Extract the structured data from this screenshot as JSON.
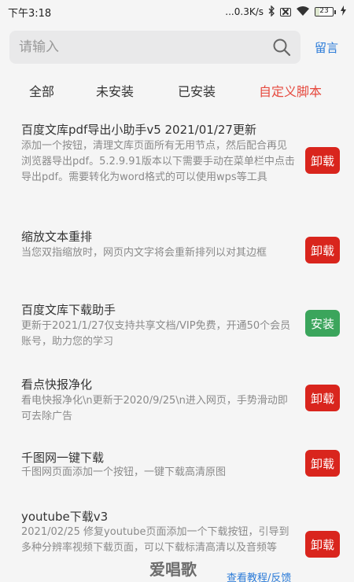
{
  "status_bar": {
    "time": "下午3:18",
    "network_speed": "...0.3K/s",
    "battery": "23",
    "battery_level": 0.23
  },
  "search": {
    "placeholder": "请输入",
    "guestbook": "留言"
  },
  "tabs": [
    {
      "label": "全部",
      "active": false
    },
    {
      "label": "未安装",
      "active": false
    },
    {
      "label": "已安装",
      "active": false
    },
    {
      "label": "自定义脚本",
      "active": true
    }
  ],
  "scripts": [
    {
      "title": "百度文库pdf导出小助手v5  2021/01/27更新",
      "description": "添加一个按钮，清理文库页面所有无用节点，然后配合再见浏览器导出pdf。5.2.9.91版本以下需要手动在菜单栏中点击导出pdf。需要转化为word格式的可以使用wps等工具",
      "action": "卸载",
      "action_type": "uninstall"
    },
    {
      "title": "缩放文本重排",
      "description": "当您双指缩放时，网页内文字将会重新排列以对其边框",
      "action": "卸载",
      "action_type": "uninstall"
    },
    {
      "title": "百度文库下载助手",
      "description": "更新于2021/1/27仅支持共享文档/VIP免费，开通50个会员账号，助力您的学习",
      "action": "安装",
      "action_type": "install"
    },
    {
      "title": "看点快报净化",
      "description": "看电快报净化\\n更新于2020/9/25\\n进入网页，手势滑动即可去除广告",
      "action": "卸载",
      "action_type": "uninstall"
    },
    {
      "title": "千图网一键下载",
      "description": "千图网页面添加一个按钮，一键下载高清原图",
      "action": "卸载",
      "action_type": "uninstall"
    },
    {
      "title": "youtube下载v3",
      "description": "2021/02/25 修复youtube页面添加一个下载按钮，引导到多种分辨率视频下载页面，可以下载标清高清以及音频等",
      "action": "卸载",
      "action_type": "uninstall"
    }
  ],
  "footer": {
    "help_link": "查看教程/反馈"
  },
  "watermark": "爱唱歌",
  "colors": {
    "accent_red": "#d9251d",
    "install_green": "#3ba55c",
    "active_tab": "#e64a3f",
    "link_blue": "#2b7bd8"
  },
  "icons": {
    "search": "search-icon",
    "bluetooth": "bluetooth-icon",
    "wifi": "wifi-icon",
    "battery": "battery-icon",
    "charging": "charging-icon",
    "sim": "sim-card-icon"
  }
}
